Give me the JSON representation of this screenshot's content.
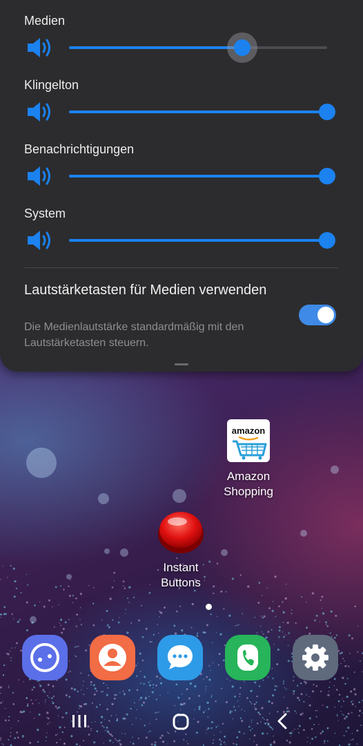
{
  "volume_panel": {
    "sliders": [
      {
        "label": "Medien",
        "level": 0.67,
        "active": true
      },
      {
        "label": "Klingelton",
        "level": 1.0,
        "active": false
      },
      {
        "label": "Benachrichtigungen",
        "level": 1.0,
        "active": false
      },
      {
        "label": "System",
        "level": 1.0,
        "active": false
      }
    ],
    "media_keys_setting": {
      "title": "Lautstärketasten für Medien verwenden",
      "description": "Die Medienlautstärke standardmäßig mit den Lautstärketasten steuern.",
      "enabled": true
    },
    "accent_color": "#1b82f0"
  },
  "home": {
    "apps": [
      {
        "name": "amazon-shopping-app",
        "label_line1": "Amazon",
        "label_line2": "Shopping",
        "logo_text": "amazon"
      },
      {
        "name": "instant-buttons-app",
        "label_line1": "Instant",
        "label_line2": "Buttons"
      }
    ],
    "page_indicator": {
      "current": 1,
      "total": 1
    },
    "dock": [
      {
        "name": "bixby-app",
        "icon": "bixby-icon",
        "color": "#5b6fe8"
      },
      {
        "name": "contacts-app",
        "icon": "person-icon",
        "color": "#f26c45"
      },
      {
        "name": "messages-app",
        "icon": "chat-bubble-icon",
        "color": "#2e9be8"
      },
      {
        "name": "phone-app",
        "icon": "phone-icon",
        "color": "#27b45a"
      },
      {
        "name": "settings-app",
        "icon": "gear-icon",
        "color": "#5f6a7d"
      }
    ]
  },
  "navigation_bar": {
    "buttons": [
      "recent-apps",
      "home",
      "back"
    ]
  }
}
